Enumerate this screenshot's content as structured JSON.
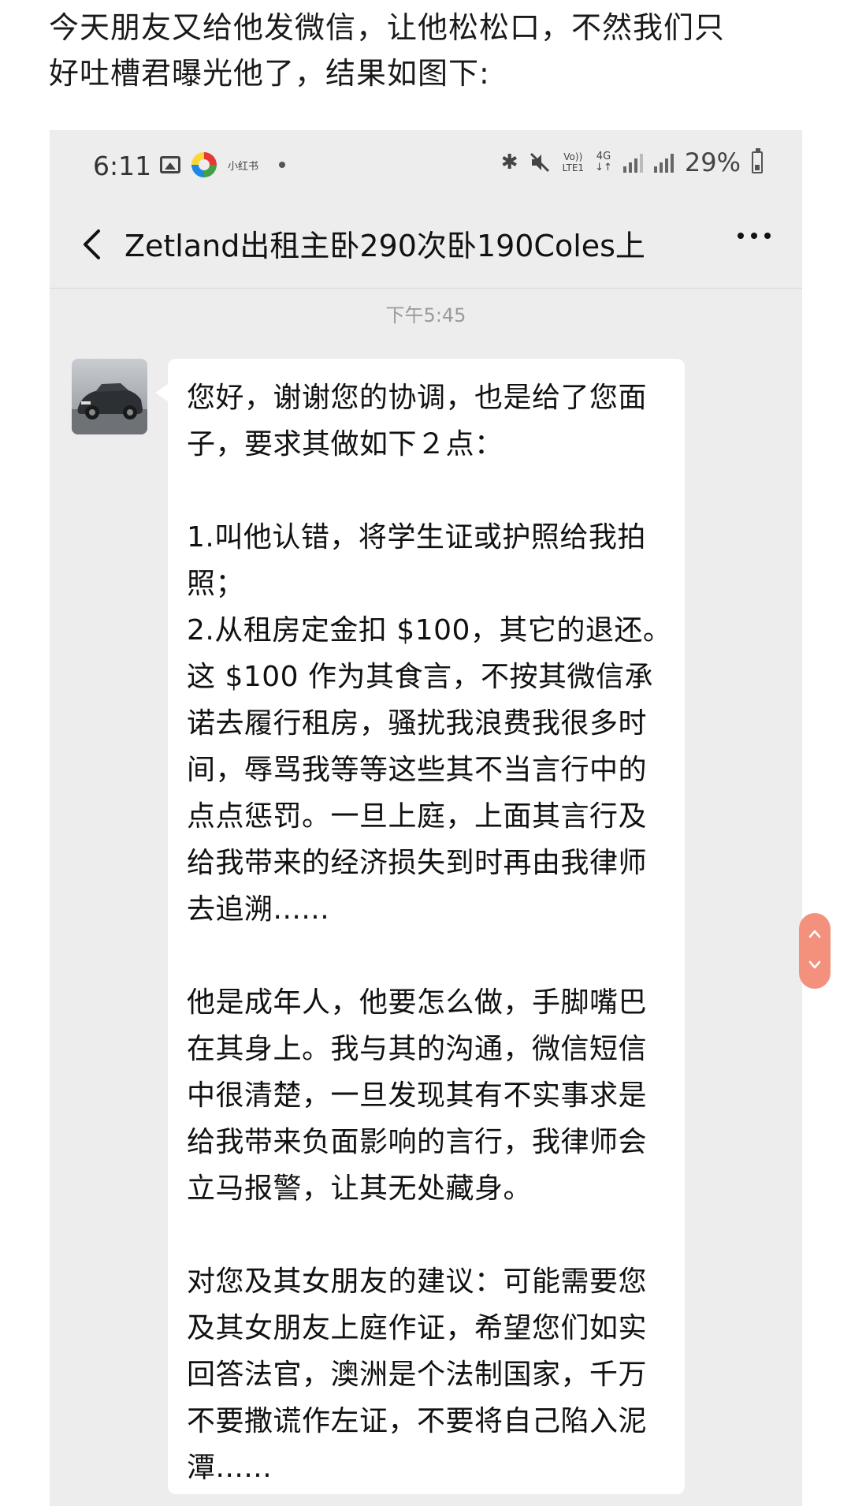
{
  "intro": {
    "line1": "今天朋友又给他发微信，让他松松口，不然我们只",
    "line2": "好吐槽君曝光他了，结果如图下:"
  },
  "status_bar": {
    "time": "6:11",
    "app_name": "小红书",
    "volte_top": "Vo))",
    "volte_bottom": "LTE1",
    "network_top": "4G",
    "network_bottom": "↓↑",
    "battery_percent": "29%",
    "icons": [
      "image-icon",
      "app-logo-icon",
      "bluetooth-icon",
      "mute-icon",
      "signal-icon",
      "battery-icon"
    ]
  },
  "chat_header": {
    "title": "Zetland出租主卧290次卧190Coles上",
    "back_icon": "chevron-left-icon",
    "more_icon": "more-dots-icon"
  },
  "timestamp": "下午5:45",
  "message": {
    "lines": [
      "您好，谢谢您的协调，也是给了您面",
      "子，要求其做如下２点：",
      "",
      "1.叫他认错，将学生证或护照给我拍",
      "照；",
      "2.从租房定金扣 $100，其它的退还。",
      "这 $100 作为其食言，不按其微信承",
      "诺去履行租房，骚扰我浪费我很多时",
      "间，辱骂我等等这些其不当言行中的",
      "点点惩罚。一旦上庭，上面其言行及",
      "给我带来的经济损失到时再由我律师",
      "去追溯......",
      "",
      "他是成年人，他要怎么做，手脚嘴巴",
      "在其身上。我与其的沟通，微信短信",
      "中很清楚，一旦发现其有不实事求是",
      "给我带来负面影响的言行，我律师会",
      "立马报警，让其无处藏身。",
      "",
      "对您及其女朋友的建议：可能需要您",
      "及其女朋友上庭作证，希望您们如实",
      "回答法官，澳洲是个法制国家，千万",
      "不要撒谎作左证，不要将自己陷入泥",
      "潭......"
    ]
  },
  "colors": {
    "chat_background": "#ededed",
    "bubble_background": "#ffffff",
    "scroll_widget": "#f4917d"
  }
}
